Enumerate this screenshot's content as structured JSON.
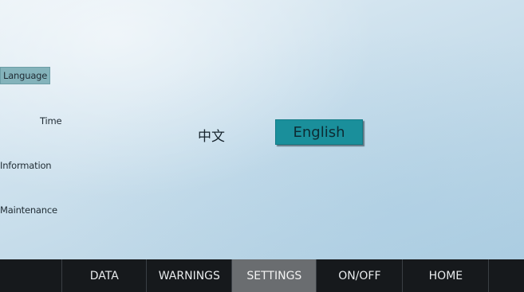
{
  "sidebar": {
    "items": [
      {
        "label": "Language",
        "active": true
      },
      {
        "label": "Time",
        "active": false
      },
      {
        "label": "Information",
        "active": false
      },
      {
        "label": "Maintenance",
        "active": false
      }
    ]
  },
  "language": {
    "chinese_label": "中文",
    "english_label": "English",
    "selected": "English"
  },
  "navbar": {
    "tabs": [
      {
        "label": "DATA"
      },
      {
        "label": "WARNINGS"
      },
      {
        "label": "SETTINGS",
        "active": true
      },
      {
        "label": "ON/OFF"
      },
      {
        "label": "HOME"
      }
    ]
  },
  "colors": {
    "selected_button": "#1a8f9b",
    "active_side_item": "#84b3bb",
    "navbar_bg": "#16191c",
    "navbar_active": "#6a6d70"
  }
}
